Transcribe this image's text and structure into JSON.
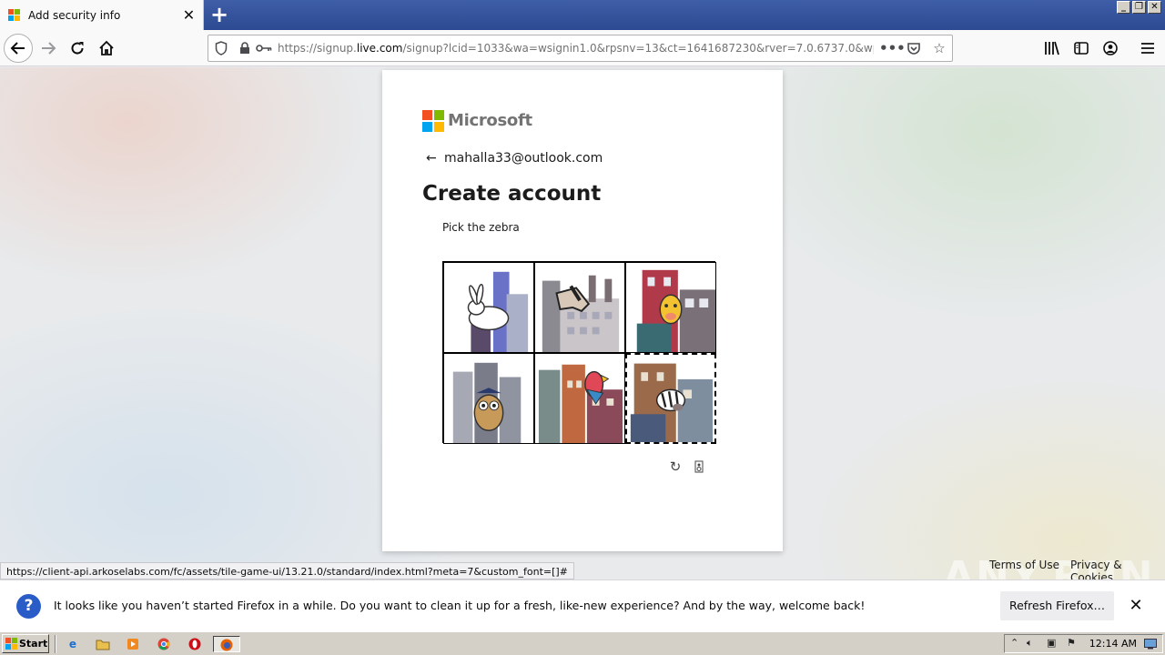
{
  "browser": {
    "tab_title": "Add security info",
    "url_display_prefix": "https://signup.",
    "url_display_domain": "live.com",
    "url_display_rest": "/signup?lcid=1033&wa=wsignin1.0&rpsnv=13&ct=1641687230&rver=7.0.6737.0&wp=MBI",
    "status_url": "https://client-api.arkoselabs.com/fc/assets/tile-game-ui/13.21.0/standard/index.html?meta=7&custom_font=[]#"
  },
  "card": {
    "brand": "Microsoft",
    "identity": "mahalla33@outlook.com",
    "title": "Create account",
    "prompt": "Pick the zebra",
    "tiles": [
      {
        "label": "rabbit",
        "selected": false
      },
      {
        "label": "horse",
        "selected": false
      },
      {
        "label": "giraffe",
        "selected": false
      },
      {
        "label": "owl",
        "selected": false
      },
      {
        "label": "parrot",
        "selected": false
      },
      {
        "label": "zebra",
        "selected": true
      }
    ]
  },
  "footer": {
    "terms": "Terms of Use",
    "privacy": "Privacy & Cookies",
    "watermark": "ANY.RUN"
  },
  "notification": {
    "text": "It looks like you haven’t started Firefox in a while. Do you want to clean it up for a fresh, like-new experience? And by the way, welcome back!",
    "button": "Refresh Firefox…"
  },
  "taskbar": {
    "start": "Start",
    "clock": "12:14 AM"
  },
  "colors": {
    "ms_red": "#f25022",
    "ms_green": "#7fba00",
    "ms_blue": "#00a4ef",
    "ms_yellow": "#ffb900",
    "tabstrip": "#2c4a91"
  }
}
